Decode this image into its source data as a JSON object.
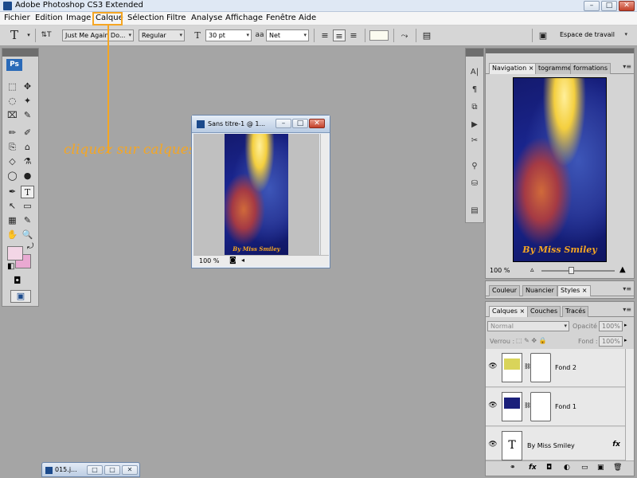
{
  "app": {
    "title": "Adobe Photoshop CS3 Extended",
    "window_buttons": [
      "–",
      "□",
      "✕"
    ]
  },
  "menu": [
    "Fichier",
    "Edition",
    "Image",
    "Calque",
    "Sélection",
    "Filtre",
    "Analyse",
    "Affichage",
    "Fenêtre",
    "Aide"
  ],
  "options": {
    "tool_glyph": "T",
    "orient_glyph": "⇅T",
    "font_family": "Just Me Again Do...",
    "font_style": "Regular",
    "size_glyph": "T",
    "font_size": "30 pt",
    "aa_label": "aa",
    "antialias": "Net",
    "align_left": "≡",
    "align_center": "≡",
    "align_right": "≡",
    "warp_glyph": "⤳",
    "palette_glyph": "▤",
    "workspace": "Espace de travail",
    "workspace_icon": "▣"
  },
  "annotation": {
    "text": "cliquez sur calques",
    "color": "#f5a623"
  },
  "tools": {
    "logo": "Ps",
    "glyphs": [
      "⬚",
      "✥",
      "◌",
      "✦",
      "⌧",
      "✎",
      "✏",
      "✐",
      "⎘",
      "⌂",
      "◇",
      "⚗",
      "◯",
      "●",
      "✒",
      "T",
      "↖",
      "▭",
      "▦",
      "✎",
      "✋",
      "🔍"
    ],
    "swap_glyph": "⤾",
    "default_colors_glyph": "◧",
    "quickmask_glyph": "◘",
    "screenmode_glyph": "▣",
    "fg_color": "#f3d6e6",
    "bg_color": "#e9a9d2"
  },
  "document": {
    "title": "Sans titre-1 @ 1...",
    "zoom": "100 %",
    "signature": "By Miss Smiley",
    "status_glyph": "◙"
  },
  "minimized": {
    "title": "015.j..."
  },
  "iconcol": [
    "A|",
    "¶",
    "⧉",
    "▶",
    "✂",
    "⚲",
    "⛁",
    "▤"
  ],
  "navigator": {
    "tabs": [
      "Navigation ×",
      "togramme",
      "formations"
    ],
    "zoom": "100 %",
    "menu_glyph": "▾≡",
    "signature": "By Miss Smiley"
  },
  "color_panel": {
    "tabs": [
      "Couleur",
      "Nuancier",
      "Styles ×"
    ],
    "menu_glyph": "▾≡"
  },
  "layers": {
    "tabs": [
      "Calques ×",
      "Couches",
      "Tracés"
    ],
    "menu_glyph": "▾≡",
    "blend_mode": "Normal",
    "opacity_label": "Opacité :",
    "opacity": "100%",
    "lock_label": "Verrou :",
    "lock_icons": "⬚ ✎ ✥ 🔒",
    "fill_label": "Fond :",
    "fill": "100%",
    "items": [
      {
        "name": "Fond 2",
        "color": "#d9d45a"
      },
      {
        "name": "Fond 1",
        "color": "#1a1f7a"
      },
      {
        "name": "By Miss Smiley",
        "glyph": "T",
        "fx": "fx"
      }
    ],
    "footer_glyphs": [
      "⚭",
      "fx",
      "◘",
      "◐",
      "▭",
      "▣",
      "🗑"
    ]
  }
}
